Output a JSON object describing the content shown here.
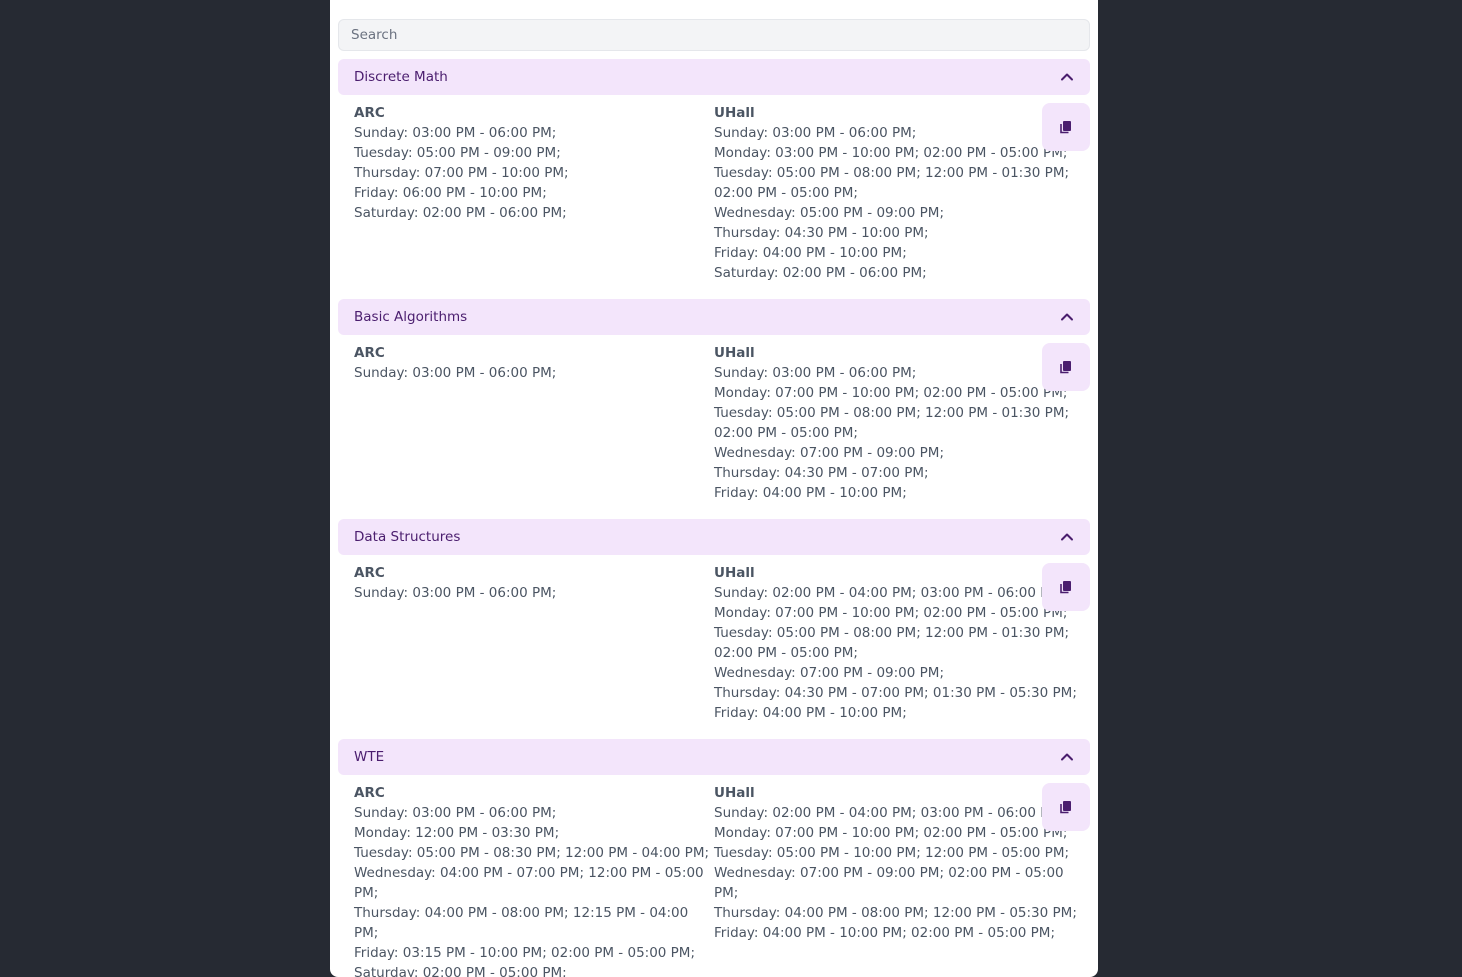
{
  "search": {
    "placeholder": "Search"
  },
  "colors": {
    "accent_bg": "#f3e5fb",
    "accent_text": "#4a1d6e",
    "page_bg": "#262a33"
  },
  "courses": [
    {
      "title": "Discrete Math",
      "left": {
        "location": "ARC",
        "lines": [
          "Sunday: 03:00 PM - 06:00 PM;",
          "Tuesday: 05:00 PM - 09:00 PM;",
          "Thursday: 07:00 PM - 10:00 PM;",
          "Friday: 06:00 PM - 10:00 PM;",
          "Saturday: 02:00 PM - 06:00 PM;"
        ]
      },
      "right": {
        "location": "UHall",
        "lines": [
          "Sunday: 03:00 PM - 06:00 PM;",
          "Monday: 03:00 PM - 10:00 PM; 02:00 PM - 05:00 PM;",
          "Tuesday: 05:00 PM - 08:00 PM; 12:00 PM - 01:30 PM; 02:00 PM - 05:00 PM;",
          "Wednesday: 05:00 PM - 09:00 PM;",
          "Thursday: 04:30 PM - 10:00 PM;",
          "Friday: 04:00 PM - 10:00 PM;",
          "Saturday: 02:00 PM - 06:00 PM;"
        ]
      }
    },
    {
      "title": "Basic Algorithms",
      "left": {
        "location": "ARC",
        "lines": [
          "Sunday: 03:00 PM - 06:00 PM;"
        ]
      },
      "right": {
        "location": "UHall",
        "lines": [
          "Sunday: 03:00 PM - 06:00 PM;",
          "Monday: 07:00 PM - 10:00 PM; 02:00 PM - 05:00 PM;",
          "Tuesday: 05:00 PM - 08:00 PM; 12:00 PM - 01:30 PM; 02:00 PM - 05:00 PM;",
          "Wednesday: 07:00 PM - 09:00 PM;",
          "Thursday: 04:30 PM - 07:00 PM;",
          "Friday: 04:00 PM - 10:00 PM;"
        ]
      }
    },
    {
      "title": "Data Structures",
      "left": {
        "location": "ARC",
        "lines": [
          "Sunday: 03:00 PM - 06:00 PM;"
        ]
      },
      "right": {
        "location": "UHall",
        "lines": [
          "Sunday: 02:00 PM - 04:00 PM; 03:00 PM - 06:00 PM;",
          "Monday: 07:00 PM - 10:00 PM; 02:00 PM - 05:00 PM;",
          "Tuesday: 05:00 PM - 08:00 PM; 12:00 PM - 01:30 PM; 02:00 PM - 05:00 PM;",
          "Wednesday: 07:00 PM - 09:00 PM;",
          "Thursday: 04:30 PM - 07:00 PM; 01:30 PM - 05:30 PM;",
          "Friday: 04:00 PM - 10:00 PM;"
        ]
      }
    },
    {
      "title": "WTE",
      "left": {
        "location": "ARC",
        "lines": [
          "Sunday: 03:00 PM - 06:00 PM;",
          "Monday: 12:00 PM - 03:30 PM;",
          "Tuesday: 05:00 PM - 08:30 PM; 12:00 PM - 04:00 PM;",
          "Wednesday: 04:00 PM - 07:00 PM; 12:00 PM - 05:00 PM;",
          "Thursday: 04:00 PM - 08:00 PM; 12:15 PM - 04:00 PM;",
          "Friday: 03:15 PM - 10:00 PM; 02:00 PM - 05:00 PM;",
          "Saturday: 02:00 PM - 05:00 PM;"
        ]
      },
      "right": {
        "location": "UHall",
        "lines": [
          "Sunday: 02:00 PM - 04:00 PM; 03:00 PM - 06:00 PM;",
          "Monday: 07:00 PM - 10:00 PM; 02:00 PM - 05:00 PM;",
          "Tuesday: 05:00 PM - 10:00 PM; 12:00 PM - 05:00 PM;",
          "Wednesday: 07:00 PM - 09:00 PM; 02:00 PM - 05:00 PM;",
          "Thursday: 04:00 PM - 08:00 PM; 12:00 PM - 05:30 PM;",
          "Friday: 04:00 PM - 10:00 PM; 02:00 PM - 05:00 PM;"
        ]
      }
    }
  ]
}
